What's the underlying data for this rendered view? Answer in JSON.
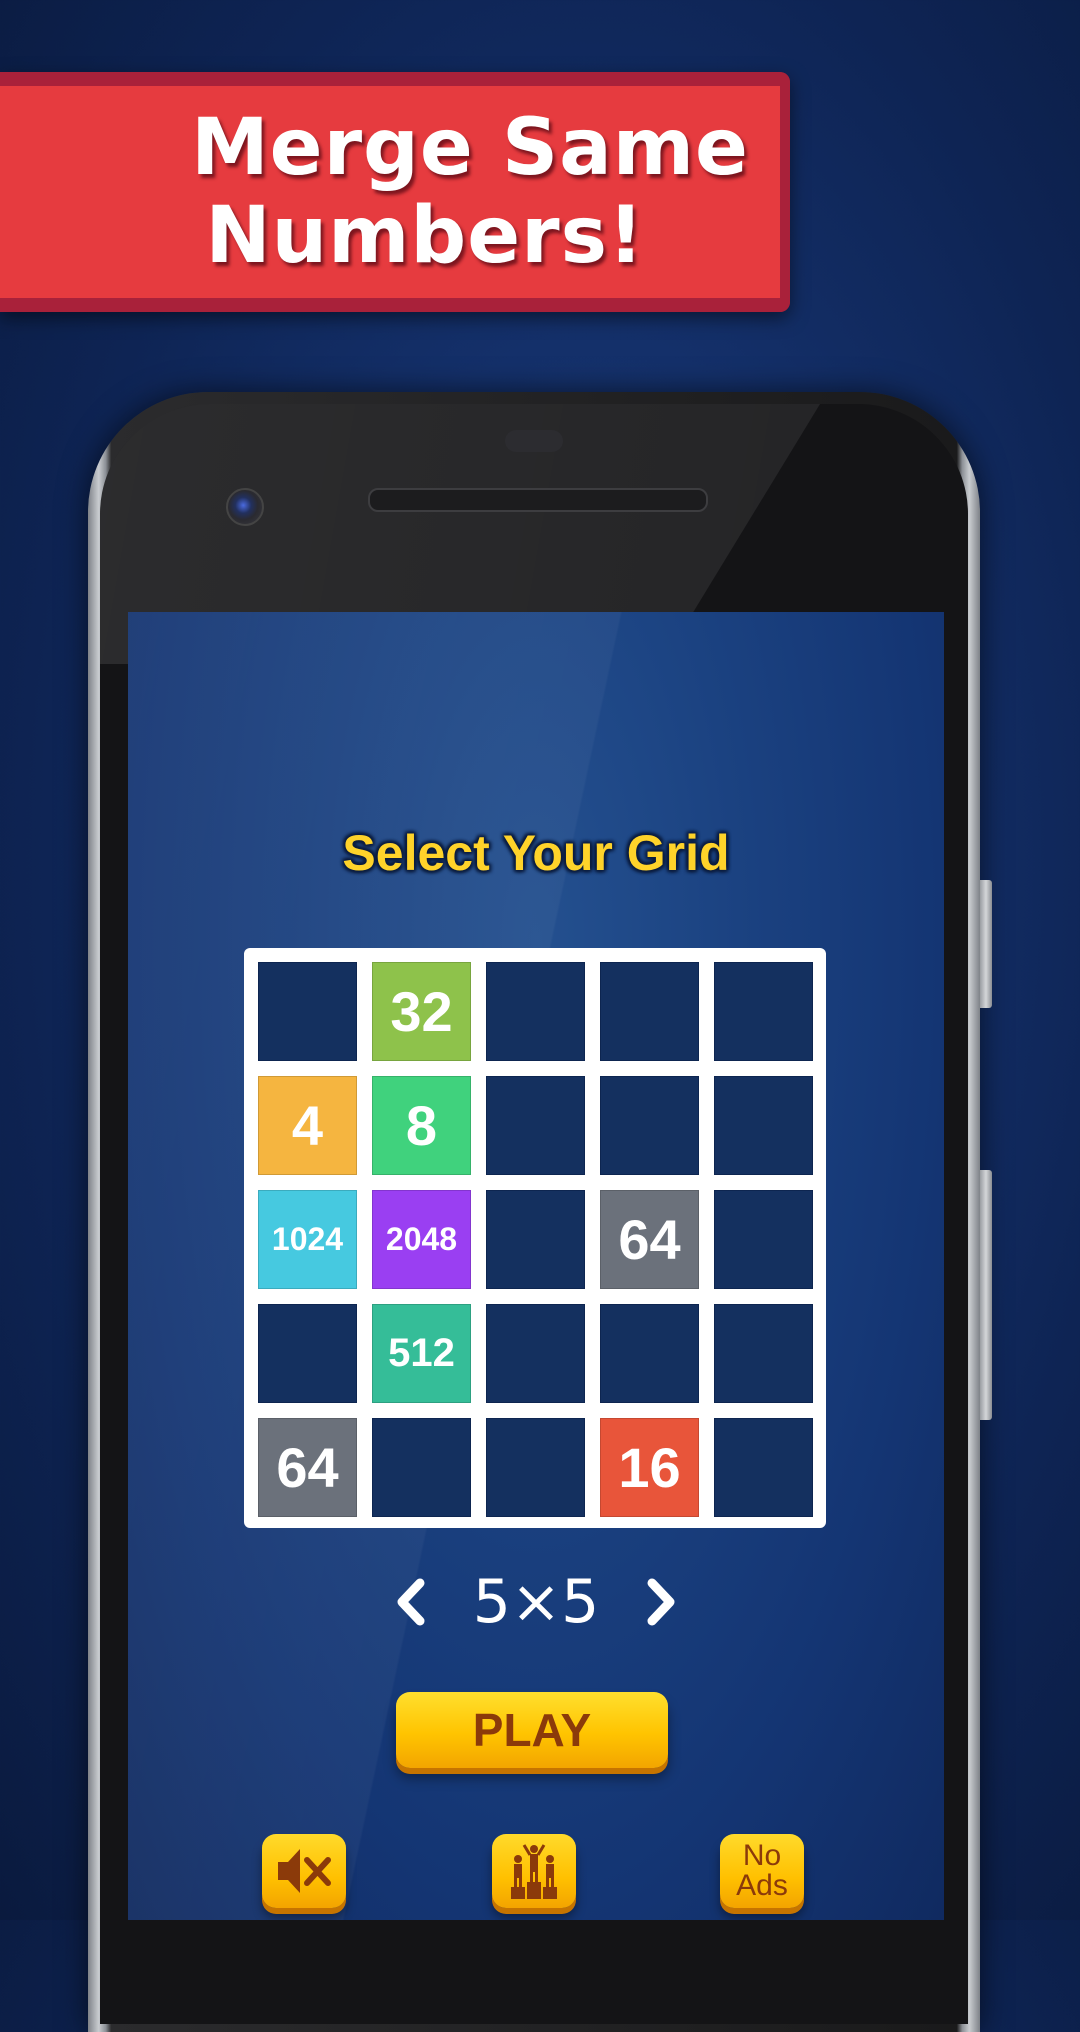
{
  "banner": {
    "line1": "Merge Same",
    "line2": "Numbers!",
    "bg_color": "#e63b3f"
  },
  "screen": {
    "title": "Select Your Grid",
    "board": {
      "rows": 5,
      "cols": 5,
      "cells": [
        [
          null,
          32,
          null,
          null,
          null
        ],
        [
          4,
          8,
          null,
          null,
          null
        ],
        [
          1024,
          2048,
          null,
          64,
          null
        ],
        [
          null,
          512,
          null,
          null,
          null
        ],
        [
          64,
          null,
          null,
          16,
          null
        ]
      ],
      "tile_colors": {
        "4": "#f5b540",
        "8": "#40d27d",
        "16": "#e8553a",
        "32": "#8ec24b",
        "64": "#6b717b",
        "512": "#35bd98",
        "1024": "#46c9e0",
        "2048": "#9a3ff2",
        "empty": "#14305f"
      }
    },
    "grid_size": {
      "label": "5×5",
      "prev_icon": "chevron-left-icon",
      "next_icon": "chevron-right-icon"
    },
    "play_button": {
      "label": "PLAY"
    },
    "bottom_buttons": [
      {
        "name": "sound-toggle",
        "icon": "speaker-muted-icon"
      },
      {
        "name": "leaderboard",
        "icon": "podium-icon"
      },
      {
        "name": "no-ads",
        "label_line1": "No",
        "label_line2": "Ads"
      }
    ]
  }
}
